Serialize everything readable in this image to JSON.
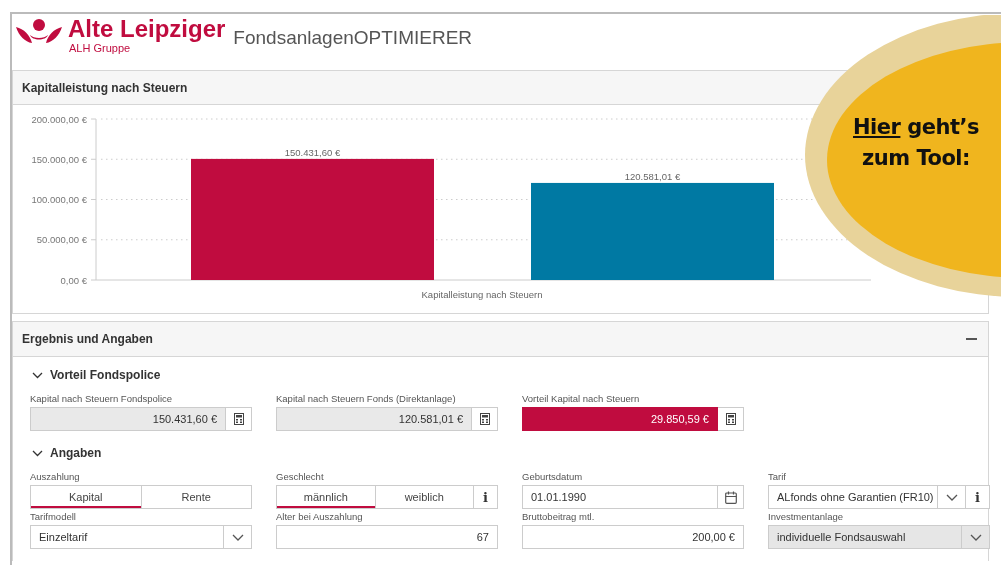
{
  "header": {
    "brand": "Alte Leipziger",
    "group": "ALH Gruppe",
    "app_title": "FondsanlagenOPTIMIERER"
  },
  "chart_panel": {
    "title": "Kapitalleistung nach Steuern",
    "chart_data": {
      "type": "bar",
      "categories": [
        "Kapitalleistung nach Steuern"
      ],
      "series": [
        {
          "color": "#c00c3f",
          "values": [
            150431.6
          ]
        },
        {
          "color": "#0079a3",
          "values": [
            120581.01
          ]
        }
      ],
      "ylim": [
        0,
        200000
      ],
      "grid": true,
      "yticks": [
        {
          "value": 0,
          "label": "0,00 €"
        },
        {
          "value": 50000,
          "label": "50.000,00 €"
        },
        {
          "value": 100000,
          "label": "100.000,00 €"
        },
        {
          "value": 150000,
          "label": "150.000,00 €"
        },
        {
          "value": 200000,
          "label": "200.000,00 €"
        }
      ],
      "value_labels": [
        "150.431,60 €",
        "120.581,01 €"
      ]
    }
  },
  "result_panel": {
    "title": "Ergebnis und Angaben",
    "sections": [
      {
        "title": "Vorteil Fondspolice",
        "expanded": true,
        "fields": [
          {
            "kind": "readonly",
            "label": "Kapital nach Steuern Fondspolice",
            "value": "150.431,60 €"
          },
          {
            "kind": "highlight_off",
            "label": "Kapital nach Steuern Fonds (Direktanlage)",
            "value": "120.581,01 €"
          },
          {
            "kind": "highlight",
            "label": "Vorteil Kapital nach Steuern",
            "value": "29.850,59 €"
          }
        ]
      },
      {
        "title": "Angaben",
        "expanded": true,
        "fields": [
          {
            "kind": "toggle",
            "label": "Auszahlung",
            "options": [
              {
                "label": "Kapital",
                "selected": true
              },
              {
                "label": "Rente",
                "selected": false
              }
            ]
          },
          {
            "kind": "toggle",
            "label": "Geschlecht",
            "info": "i",
            "options": [
              {
                "label": "männlich",
                "selected": true
              },
              {
                "label": "weiblich",
                "selected": false
              }
            ]
          },
          {
            "kind": "date",
            "label": "Geburtsdatum",
            "value": "01.01.1990"
          },
          {
            "kind": "select",
            "label": "Tarif",
            "value": "ALfonds ohne Garantien (FR10)",
            "info": "i",
            "disabled": false
          },
          {
            "kind": "select",
            "label": "Tarifmodell",
            "value": "Einzeltarif",
            "disabled": false
          },
          {
            "kind": "number",
            "label": "Alter bei Auszahlung",
            "value": "67"
          },
          {
            "kind": "number",
            "label": "Bruttobeitrag mtl.",
            "value": "200,00 €"
          },
          {
            "kind": "select",
            "label": "Investmentanlage",
            "value": "individuelle Fondsauswahl",
            "disabled": true
          }
        ]
      }
    ]
  },
  "callout": {
    "link": "Hier",
    "text": "geht’s zum Tool:"
  }
}
